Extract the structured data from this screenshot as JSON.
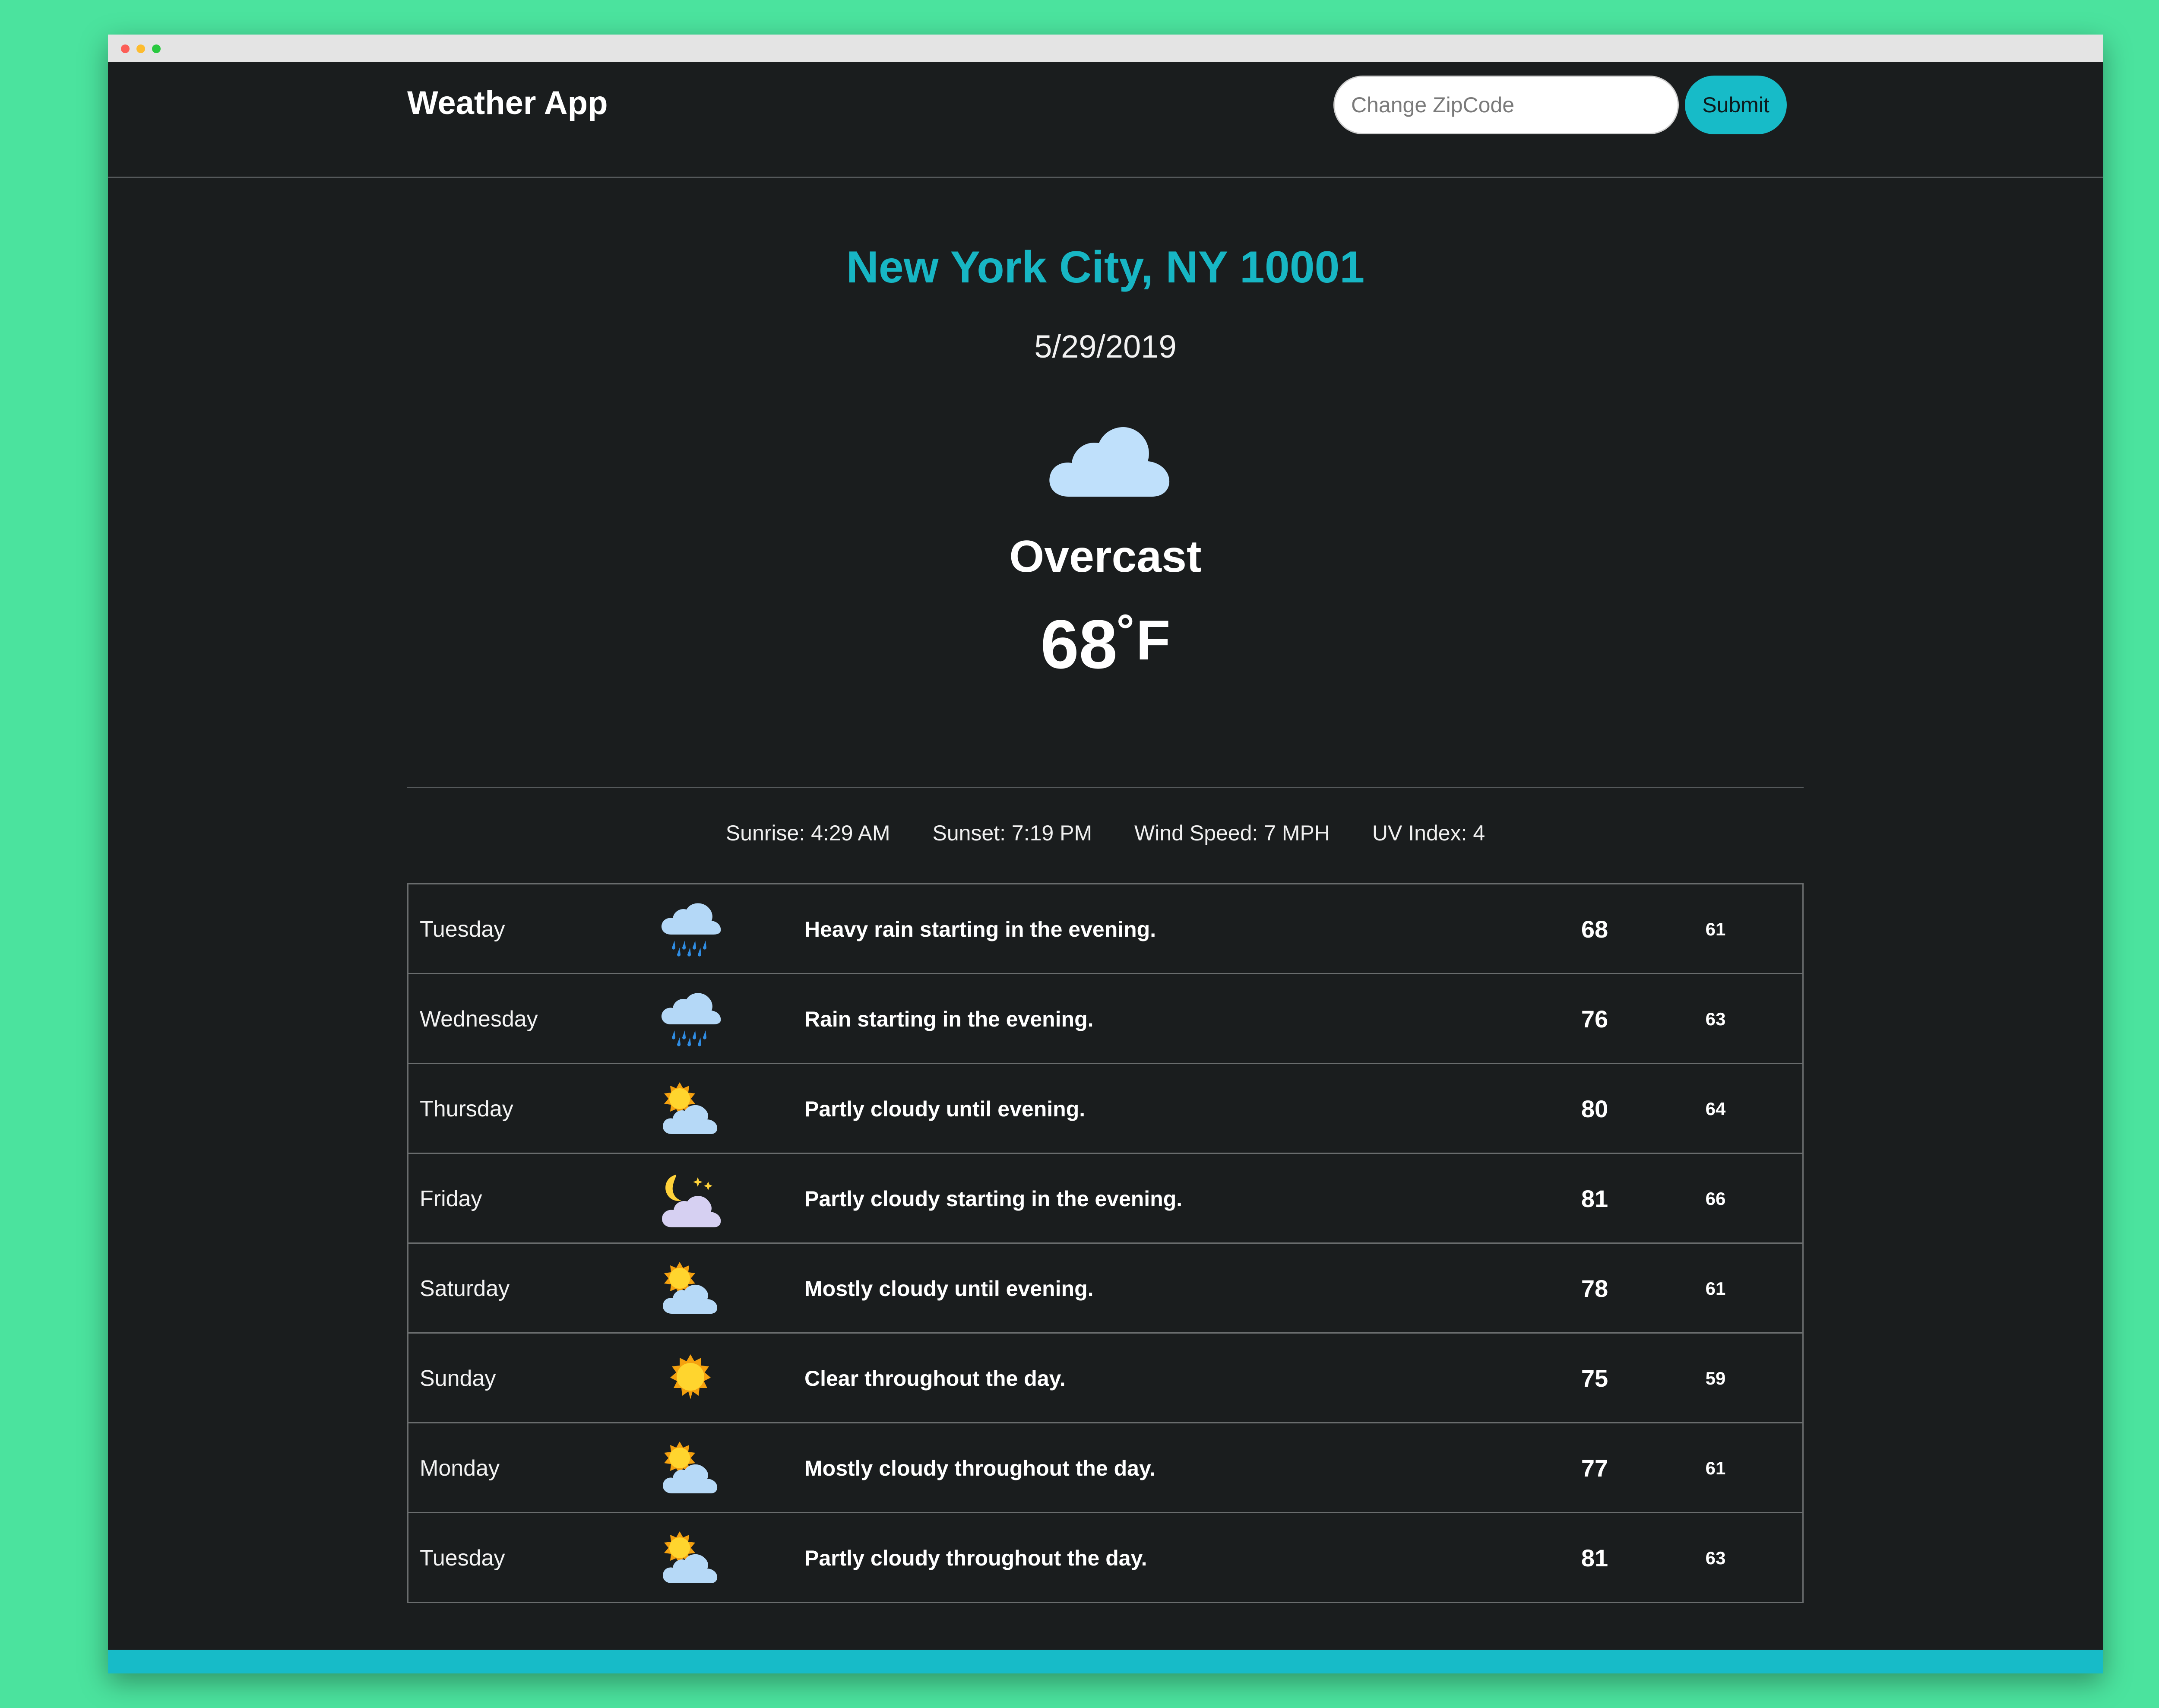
{
  "app": {
    "title": "Weather App",
    "accent_color": "#17bbc8"
  },
  "search": {
    "placeholder": "Change ZipCode",
    "value": "",
    "submit_label": "Submit"
  },
  "current": {
    "location": "New York City, NY 10001",
    "date": "5/29/2019",
    "icon": "cloud-icon",
    "condition": "Overcast",
    "temperature": "68",
    "unit": "˚F"
  },
  "stats": {
    "sunrise": "Sunrise: 4:29 AM",
    "sunset": "Sunset: 7:19 PM",
    "wind": "Wind Speed: 7 MPH",
    "uv": "UV Index: 4"
  },
  "forecast": [
    {
      "day": "Tuesday",
      "icon": "rain-icon",
      "summary": "Heavy rain starting in the evening.",
      "high": "68",
      "low": "61"
    },
    {
      "day": "Wednesday",
      "icon": "rain-icon",
      "summary": "Rain starting in the evening.",
      "high": "76",
      "low": "63"
    },
    {
      "day": "Thursday",
      "icon": "partly-cloudy-day-icon",
      "summary": "Partly cloudy until evening.",
      "high": "80",
      "low": "64"
    },
    {
      "day": "Friday",
      "icon": "partly-cloudy-night-icon",
      "summary": "Partly cloudy starting in the evening.",
      "high": "81",
      "low": "66"
    },
    {
      "day": "Saturday",
      "icon": "partly-cloudy-day-icon",
      "summary": "Mostly cloudy until evening.",
      "high": "78",
      "low": "61"
    },
    {
      "day": "Sunday",
      "icon": "sun-icon",
      "summary": "Clear throughout the day.",
      "high": "75",
      "low": "59"
    },
    {
      "day": "Monday",
      "icon": "partly-cloudy-day-icon",
      "summary": "Mostly cloudy throughout the day.",
      "high": "77",
      "low": "61"
    },
    {
      "day": "Tuesday",
      "icon": "partly-cloudy-day-icon",
      "summary": "Partly cloudy throughout the day.",
      "high": "81",
      "low": "63"
    }
  ]
}
